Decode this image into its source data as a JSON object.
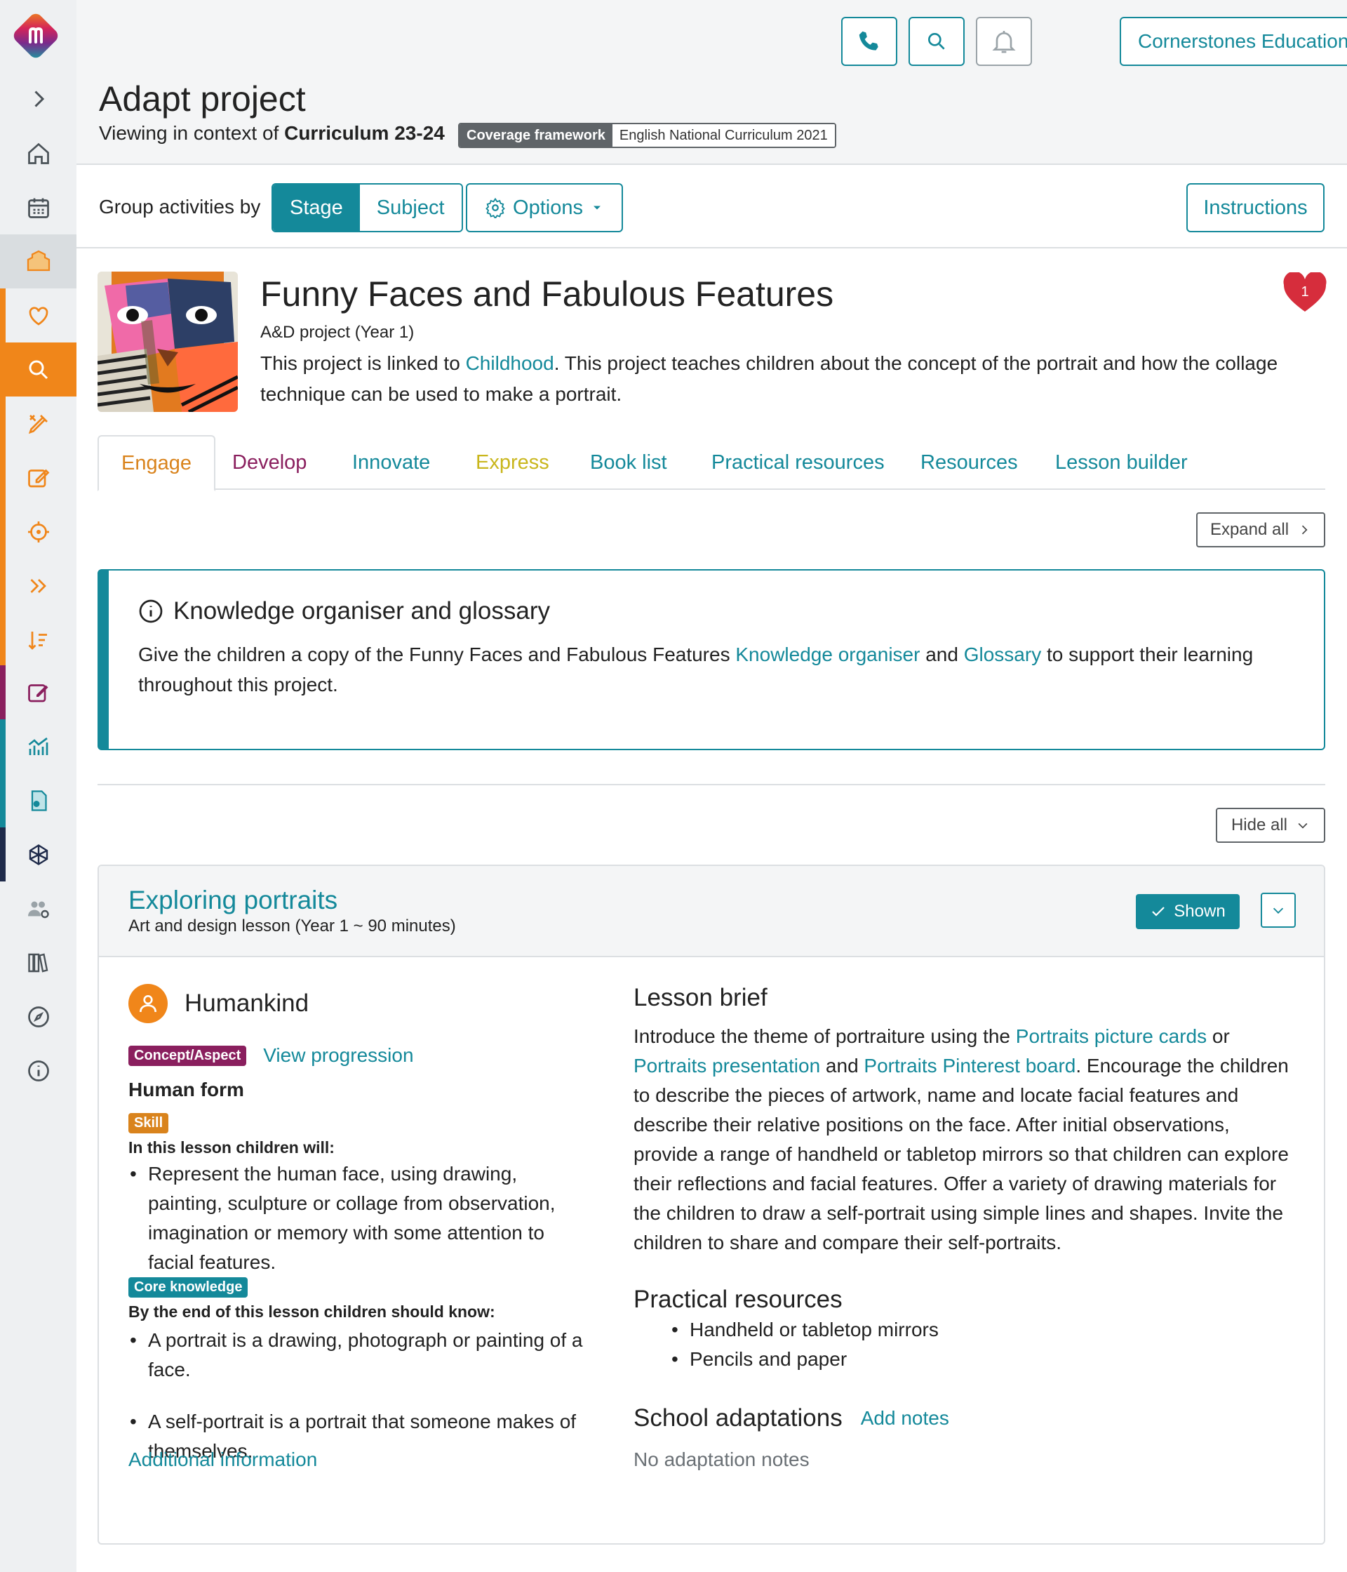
{
  "header": {
    "org_name": "Cornerstones Education",
    "page_title": "Adapt project",
    "context_prefix": "Viewing in context of",
    "context_curriculum": "Curriculum 23-24",
    "coverage_key": "Coverage framework",
    "coverage_value": "English National Curriculum 2021"
  },
  "toolbar": {
    "group_label": "Group activities by",
    "stage_label": "Stage",
    "subject_label": "Subject",
    "options_label": "Options",
    "instructions_label": "Instructions"
  },
  "project": {
    "title": "Funny Faces and Fabulous Features",
    "subtitle": "A&D project (Year 1)",
    "desc_prefix": "This project is linked to",
    "desc_link": "Childhood",
    "desc_suffix": ". This project teaches children about the concept of the portrait and how the collage technique can be used to make a portrait.",
    "likes": "1"
  },
  "tabs": [
    {
      "label": "Engage",
      "color": "#d9831c"
    },
    {
      "label": "Develop",
      "color": "#8a1f5e"
    },
    {
      "label": "Innovate",
      "color": "#14899a"
    },
    {
      "label": "Express",
      "color": "#c9b61c"
    },
    {
      "label": "Book list",
      "color": "#14899a"
    },
    {
      "label": "Practical resources",
      "color": "#14899a"
    },
    {
      "label": "Resources",
      "color": "#14899a"
    },
    {
      "label": "Lesson builder",
      "color": "#14899a"
    }
  ],
  "expand_all": "Expand all",
  "hide_all": "Hide all",
  "info": {
    "title": "Knowledge organiser and glossary",
    "text_prefix": "Give the children a copy of the Funny Faces and Fabulous Features",
    "link1": "Knowledge organiser",
    "and": "and",
    "link2": "Glossary",
    "text_suffix": "to support their learning throughout this project."
  },
  "lesson": {
    "title": "Exploring portraits",
    "subtitle": "Art and design lesson (Year 1 ~ 90 minutes)",
    "shown_label": "Shown",
    "theme": "Humankind",
    "concept_badge": "Concept/Aspect",
    "view_progression": "View progression",
    "concept_value": "Human form",
    "skill_badge": "Skill",
    "skill_intro": "In this lesson children will:",
    "skills": [
      "Represent the human face, using drawing, painting, sculpture or collage from observation, imagination or memory with some attention to facial features."
    ],
    "core_badge": "Core knowledge",
    "core_intro": "By the end of this lesson children should know:",
    "core_items": [
      "A portrait is a drawing, photograph or painting of a face.",
      "A self-portrait is a portrait that someone makes of themselves."
    ],
    "additional_info": "Additional information",
    "brief_title": "Lesson brief",
    "brief_p1": "Introduce the theme of portraiture using the",
    "brief_link1": "Portraits picture cards",
    "brief_or": "or",
    "brief_link2": "Portraits presentation",
    "brief_and": "and",
    "brief_link3": "Portraits Pinterest board",
    "brief_rest": ". Encourage the children to describe the pieces of artwork, name and locate facial features and describe their relative positions on the face. After initial observations, provide a range of handheld or tabletop mirrors so that children can explore their reflections and facial features. Offer a variety of drawing materials for the children to draw a self-portrait using simple lines and shapes. Invite the children to share and compare their self-portraits.",
    "practical_title": "Practical resources",
    "practical_items": [
      "Handheld or tabletop mirrors",
      "Pencils and paper"
    ],
    "adapt_title": "School adaptations",
    "add_notes": "Add notes",
    "no_notes": "No adaptation notes"
  }
}
